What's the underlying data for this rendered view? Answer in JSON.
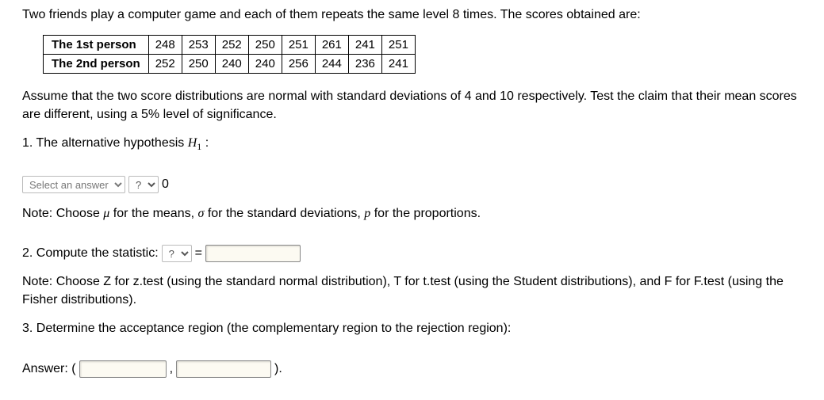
{
  "intro": "Two friends play a computer game and each of them repeats the same level 8 times. The scores obtained are:",
  "table": {
    "row1_label": "The 1st person",
    "row2_label": "The 2nd person",
    "row1": [
      "248",
      "253",
      "252",
      "250",
      "251",
      "261",
      "241",
      "251"
    ],
    "row2": [
      "252",
      "250",
      "240",
      "240",
      "256",
      "244",
      "236",
      "241"
    ]
  },
  "assume": "Assume that the two score distributions are normal with standard deviations of 4 and 10 respectively. Test the claim that their mean scores are different, using a 5% level of significance.",
  "q1": {
    "lead": "1. The alternative hypothesis ",
    "hvar": "H",
    "hsub": "1",
    "colon": " :",
    "select_placeholder": "Select an answer",
    "op_placeholder": "?",
    "zero": "0"
  },
  "note1": {
    "pre": "Note: Choose ",
    "mu": "μ",
    "t1": " for the means, ",
    "sigma": "σ",
    "t2": " for the standard deviations, ",
    "p": "p",
    "t3": " for the proportions."
  },
  "q2": {
    "label": "2. Compute the statistic: ",
    "stat_placeholder": "?",
    "eq": "="
  },
  "note2": "Note: Choose Z for z.test (using the standard normal distribution), T for t.test (using the Student distributions), and F for F.test (using the Fisher distributions).",
  "q3": "3. Determine the acceptance region (the complementary region to the rejection region):",
  "answer": {
    "label": "Answer: (",
    "comma": ",",
    "end": ")."
  }
}
